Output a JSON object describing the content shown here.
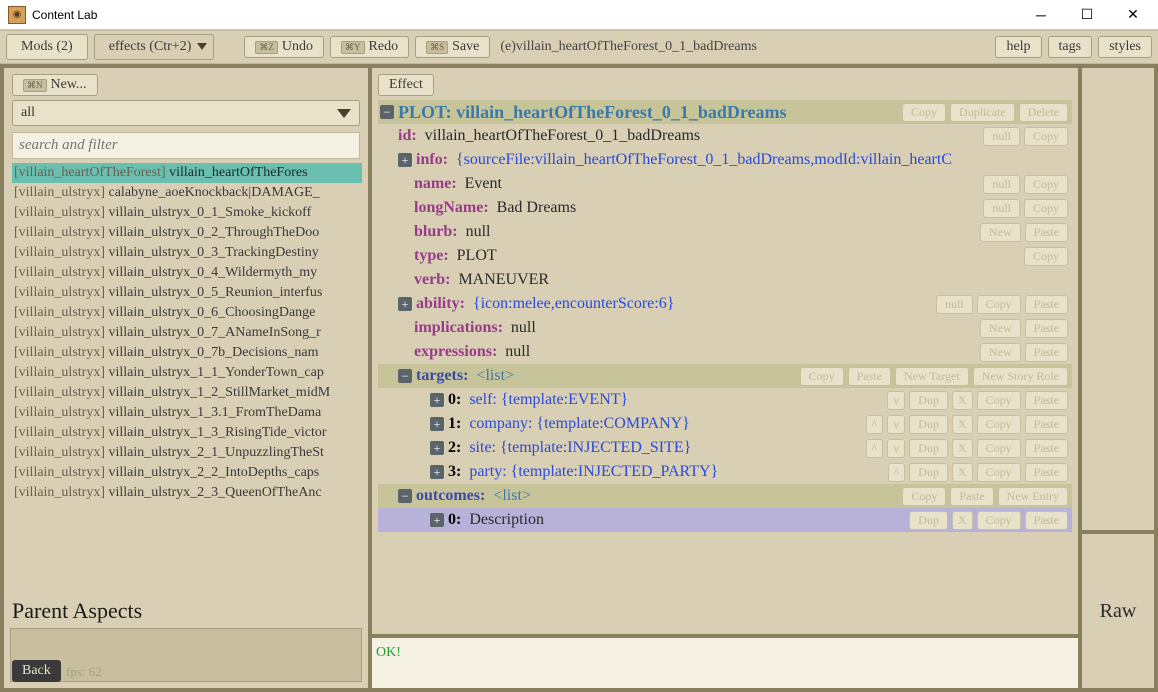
{
  "window": {
    "title": "Content Lab"
  },
  "toolbar": {
    "mods": "Mods (2)",
    "tabs": "effects (Ctr+2)",
    "undo": "Undo",
    "redo": "Redo",
    "save": "Save",
    "path": "(e)villain_heartOfTheForest_0_1_badDreams",
    "help": "help",
    "tags": "tags",
    "styles": "styles"
  },
  "left": {
    "new": "New...",
    "filter": "all",
    "search_placeholder": "search and filter",
    "parent_aspects": "Parent Aspects",
    "items": [
      {
        "prefix": "[villain_heartOfTheForest]",
        "name": "villain_heartOfTheFores",
        "selected": true
      },
      {
        "prefix": "[villain_ulstryx]",
        "name": "calabyne_aoeKnockback|DAMAGE_"
      },
      {
        "prefix": "[villain_ulstryx]",
        "name": "villain_ulstryx_0_1_Smoke_kickoff"
      },
      {
        "prefix": "[villain_ulstryx]",
        "name": "villain_ulstryx_0_2_ThroughTheDoo"
      },
      {
        "prefix": "[villain_ulstryx]",
        "name": "villain_ulstryx_0_3_TrackingDestiny"
      },
      {
        "prefix": "[villain_ulstryx]",
        "name": "villain_ulstryx_0_4_Wildermyth_my"
      },
      {
        "prefix": "[villain_ulstryx]",
        "name": "villain_ulstryx_0_5_Reunion_interfus"
      },
      {
        "prefix": "[villain_ulstryx]",
        "name": "villain_ulstryx_0_6_ChoosingDange"
      },
      {
        "prefix": "[villain_ulstryx]",
        "name": "villain_ulstryx_0_7_ANameInSong_r"
      },
      {
        "prefix": "[villain_ulstryx]",
        "name": "villain_ulstryx_0_7b_Decisions_nam"
      },
      {
        "prefix": "[villain_ulstryx]",
        "name": "villain_ulstryx_1_1_YonderTown_cap"
      },
      {
        "prefix": "[villain_ulstryx]",
        "name": "villain_ulstryx_1_2_StillMarket_midM"
      },
      {
        "prefix": "[villain_ulstryx]",
        "name": "villain_ulstryx_1_3.1_FromTheDama"
      },
      {
        "prefix": "[villain_ulstryx]",
        "name": "villain_ulstryx_1_3_RisingTide_victor"
      },
      {
        "prefix": "[villain_ulstryx]",
        "name": "villain_ulstryx_2_1_UnpuzzlingTheSt"
      },
      {
        "prefix": "[villain_ulstryx]",
        "name": "villain_ulstryx_2_2_IntoDepths_caps"
      },
      {
        "prefix": "[villain_ulstryx]",
        "name": "villain_ulstryx_2_3_QueenOfTheAnc"
      }
    ]
  },
  "editor": {
    "effect": "Effect",
    "plot_label": "PLOT:",
    "plot_name": "villain_heartOfTheForest_0_1_badDreams",
    "fields": {
      "id": {
        "key": "id:",
        "val": "villain_heartOfTheForest_0_1_badDreams"
      },
      "info": {
        "key": "info:",
        "val": "{sourceFile:villain_heartOfTheForest_0_1_badDreams,modId:villain_heartC"
      },
      "name": {
        "key": "name:",
        "val": "Event"
      },
      "longName": {
        "key": "longName:",
        "val": "Bad Dreams"
      },
      "blurb": {
        "key": "blurb:",
        "val": "null"
      },
      "type": {
        "key": "type:",
        "val": "PLOT"
      },
      "verb": {
        "key": "verb:",
        "val": "MANEUVER"
      },
      "ability": {
        "key": "ability:",
        "val": "{icon:melee,encounterScore:6}"
      },
      "implications": {
        "key": "implications:",
        "val": "null"
      },
      "expressions": {
        "key": "expressions:",
        "val": "null"
      },
      "targets": {
        "key": "targets:",
        "val": "<list>"
      },
      "t0": {
        "key": "0:",
        "val_a": "self:",
        "val_b": "{template:EVENT}"
      },
      "t1": {
        "key": "1:",
        "val_a": "company:",
        "val_b": "{template:COMPANY}"
      },
      "t2": {
        "key": "2:",
        "val_a": "site:",
        "val_b": "{template:INJECTED_SITE}"
      },
      "t3": {
        "key": "3:",
        "val_a": "party:",
        "val_b": "{template:INJECTED_PARTY}"
      },
      "outcomes": {
        "key": "outcomes:",
        "val": "<list>"
      },
      "o0": {
        "key": "0:",
        "val": "Description"
      }
    },
    "btns": {
      "copy": "Copy",
      "duplicate": "Duplicate",
      "delete": "Delete",
      "null": "null",
      "paste": "Paste",
      "new": "New",
      "newtarget": "New Target",
      "newstory": "New Story Role",
      "dup": "Dup",
      "x": "X",
      "up": "^",
      "down": "v",
      "newentry": "New Entry"
    }
  },
  "console": {
    "ok": "OK!"
  },
  "right": {
    "raw": "Raw"
  },
  "footer": {
    "back": "Back",
    "fps": "fps: 62"
  }
}
